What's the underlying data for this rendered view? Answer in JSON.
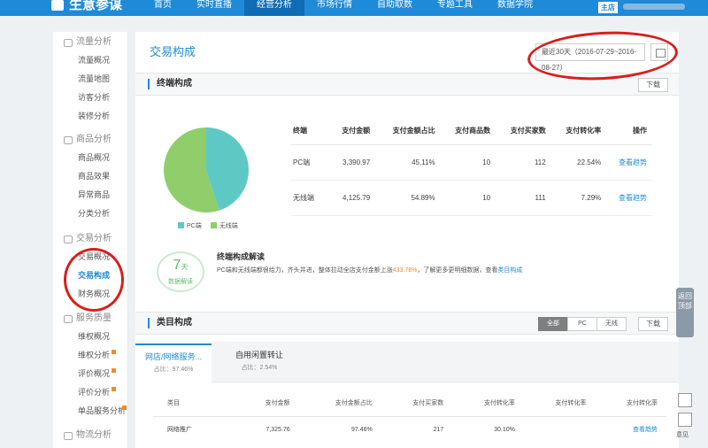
{
  "brand": {
    "name": "生意参谋"
  },
  "topnav": [
    "首页",
    "实时直播",
    "经营分析",
    "市场行情",
    "自助取数",
    "专题工具",
    "数据学院"
  ],
  "topnav_active": 2,
  "shop_badge": "主店",
  "sidebar": {
    "groups": [
      {
        "title": "流量分析",
        "items": [
          "流量概况",
          "流量地图",
          "访客分析",
          "装修分析"
        ]
      },
      {
        "title": "商品分析",
        "items": [
          "商品概况",
          "商品效果",
          "异常商品",
          "分类分析"
        ]
      },
      {
        "title": "交易分析",
        "items": [
          "交易概况",
          "交易构成",
          "财务概况"
        ]
      },
      {
        "title": "服务质量",
        "items": [
          "维权概况",
          "维权分析",
          "评价概况",
          "评价分析",
          "单品服务分析"
        ]
      },
      {
        "title": "物流分析",
        "items": []
      }
    ],
    "active_item": "交易构成"
  },
  "page": {
    "title": "交易构成",
    "date_range": "最近30天（2016-07-29~2016-08-27）"
  },
  "terminal": {
    "section_title": "终端构成",
    "download": "下载",
    "legend": [
      "PC端",
      "无线端"
    ],
    "colors": {
      "pc": "#5ec9c4",
      "wireless": "#8fce6a"
    },
    "columns": [
      "终端",
      "支付金额",
      "支付金额占比",
      "支付商品数",
      "支付买家数",
      "支付转化率",
      "操作"
    ],
    "rows": [
      {
        "name": "PC端",
        "amount": "3,390.97",
        "share": "45.11%",
        "items": "10",
        "buyers": "112",
        "conv": "22.54%",
        "action": "查看趋势"
      },
      {
        "name": "无线端",
        "amount": "4,125.79",
        "share": "54.89%",
        "items": "10",
        "buyers": "111",
        "conv": "7.29%",
        "action": "查看趋势"
      }
    ],
    "pie_shares": [
      45.11,
      54.89
    ]
  },
  "interpret": {
    "days": "7",
    "days_unit": "天",
    "days_label": "数据解读",
    "title": "终端构成解读",
    "text_a": "PC端和无线端都很给力，齐头并进，整体拉动全店支付金额上涨",
    "highlight": "433.78%",
    "text_b": "，了解更多更明细数据，查看",
    "link": "类目构成"
  },
  "category": {
    "section_title": "类目构成",
    "filters": [
      "全部",
      "PC",
      "无线"
    ],
    "active_filter": "全部",
    "download": "下载",
    "tabs": [
      {
        "name": "网店/网络服务...",
        "share": "占比：97.46%"
      },
      {
        "name": "自用闲置转让",
        "share": "占比：2.54%"
      }
    ],
    "columns": [
      "类目",
      "支付金额",
      "支付金额占比",
      "支付买家数",
      "支付转化率",
      "支付转化率",
      "支付转化率"
    ],
    "rows": [
      {
        "name": "网络推广",
        "amount": "7,325.76",
        "share": "97.46%",
        "buyers": "217",
        "conv": "30.10%",
        "action": "查看趋势"
      }
    ]
  },
  "float": {
    "backtop": "返回顶部",
    "feedback": "意见"
  }
}
